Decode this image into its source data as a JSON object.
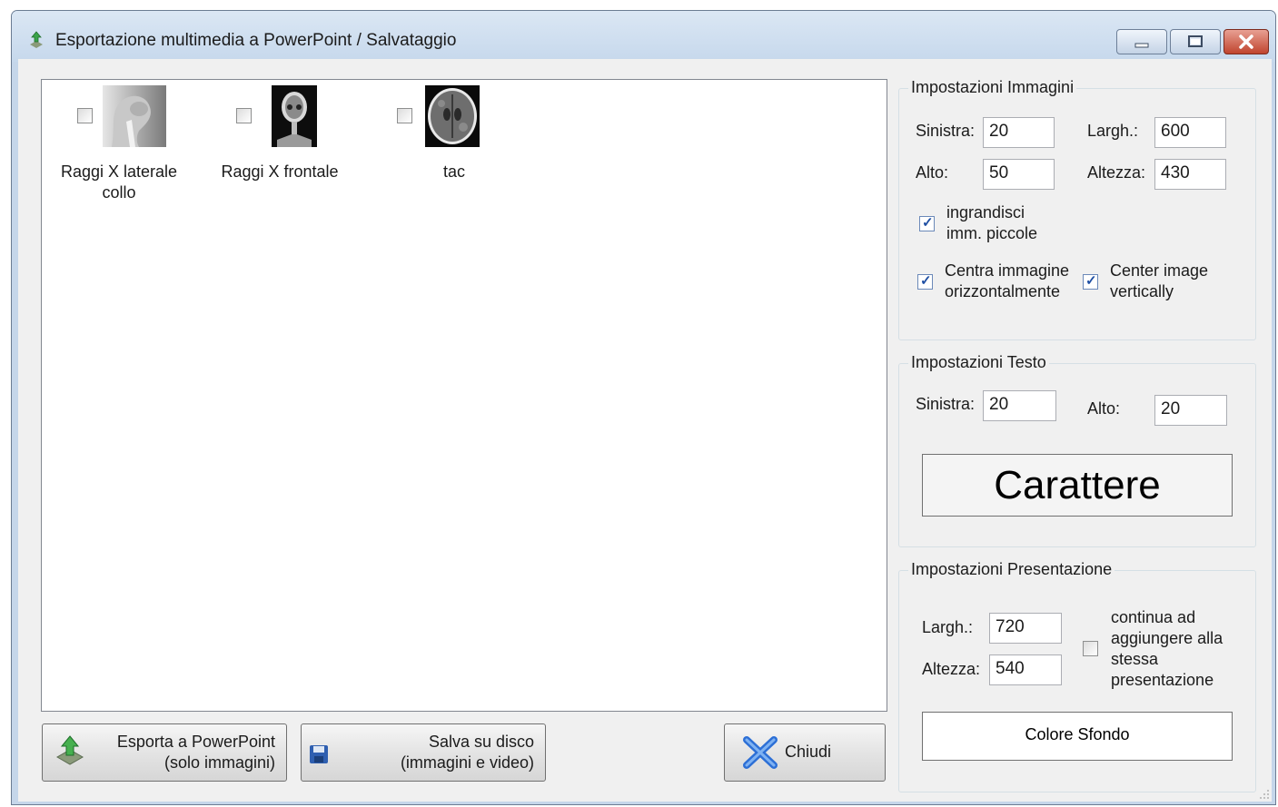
{
  "window": {
    "title": "Esportazione multimedia a PowerPoint / Salvataggio",
    "icon": "powerpoint-export-icon"
  },
  "gallery": {
    "items": [
      {
        "label": "Raggi X laterale collo",
        "checked": false,
        "thumbnail": "xray-lateral-neck"
      },
      {
        "label": "Raggi X frontale",
        "checked": false,
        "thumbnail": "xray-frontal-skull"
      },
      {
        "label": "tac",
        "checked": false,
        "thumbnail": "ct-brain-scan"
      }
    ]
  },
  "buttons": {
    "export_line1": "Esporta a PowerPoint",
    "export_line2": "(solo immagini)",
    "save_line1": "Salva su disco",
    "save_line2": "(immagini e video)",
    "close": "Chiudi"
  },
  "image_settings": {
    "title": "Impostazioni Immagini",
    "left_label": "Sinistra:",
    "left_value": "20",
    "width_label": "Largh.:",
    "width_value": "600",
    "top_label": "Alto:",
    "top_value": "50",
    "height_label": "Altezza:",
    "height_value": "430",
    "enlarge_line1": "ingrandisci",
    "enlarge_line2": "imm. piccole",
    "enlarge_checked": true,
    "center_h_line1": "Centra immagine",
    "center_h_line2": "orizzontalmente",
    "center_h_checked": true,
    "center_v_line1": "Center image",
    "center_v_line2": "vertically",
    "center_v_checked": true
  },
  "text_settings": {
    "title": "Impostazioni Testo",
    "left_label": "Sinistra:",
    "left_value": "20",
    "top_label": "Alto:",
    "top_value": "20",
    "font_button": "Carattere"
  },
  "presentation_settings": {
    "title": "Impostazioni Presentazione",
    "width_label": "Largh.:",
    "width_value": "720",
    "height_label": "Altezza:",
    "height_value": "540",
    "continue_line1": "continua ad",
    "continue_line2": "aggiungere alla",
    "continue_line3": "stessa",
    "continue_line4": "presentazione",
    "continue_checked": false,
    "bg_color_button": "Colore Sfondo"
  }
}
